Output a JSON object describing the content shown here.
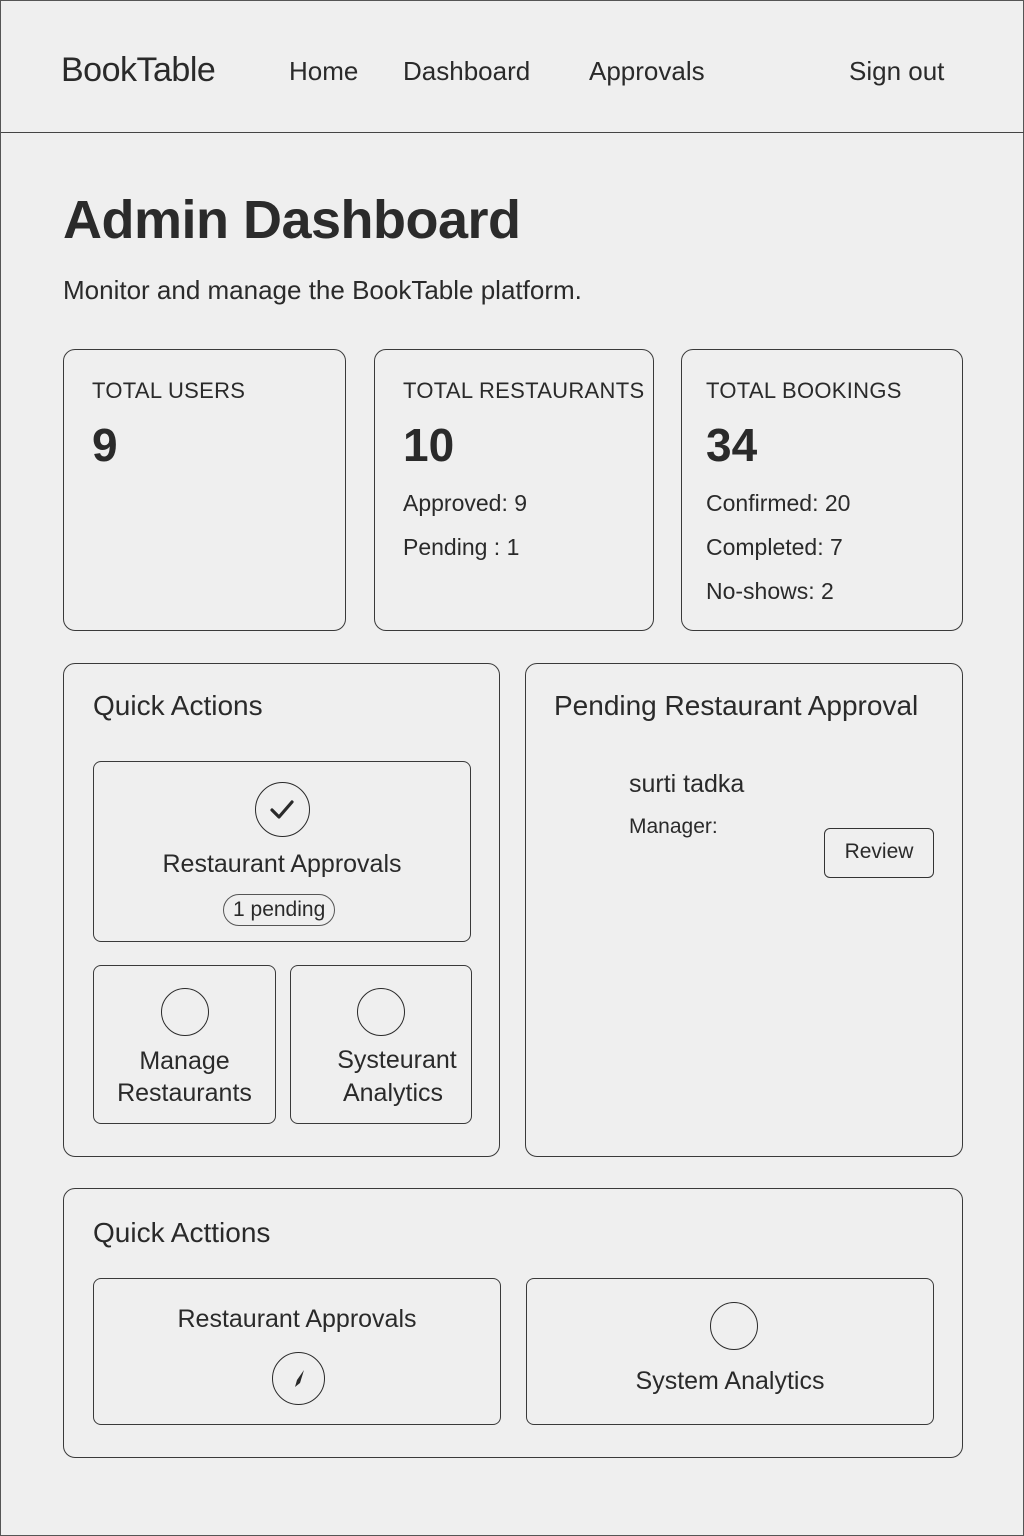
{
  "header": {
    "brand": "BookTable",
    "nav": {
      "home": "Home",
      "dashboard": "Dashboard",
      "approvals": "Approvals",
      "signout": "Sign out"
    }
  },
  "page": {
    "title": "Admin Dashboard",
    "subtitle": "Monitor and manage the BookTable platform."
  },
  "stats": {
    "users": {
      "label": "TOTAL USERS",
      "value": "9"
    },
    "restaurants": {
      "label": "TOTAL RESTAURANTS",
      "value": "10",
      "approved": "Approved:  9",
      "pending": "Pending : 1"
    },
    "bookings": {
      "label": "TOTAL BOOKINGS",
      "value": "34",
      "confirmed": "Confirmed: 20",
      "completed": "Completed: 7",
      "noshows": "No-shows:  2"
    }
  },
  "quick_actions": {
    "title": "Quick Actions",
    "restaurant_approvals": {
      "label": "Restaurant Approvals",
      "badge": "1 pending",
      "icon": "check-circle-icon"
    },
    "manage_restaurants": {
      "line1": "Manage",
      "line2": "Restaurants",
      "icon": "circle-icon"
    },
    "systeurant_analytics": {
      "line1": "Systeurant",
      "line2": "Analytics",
      "icon": "circle-icon"
    }
  },
  "pending_approval": {
    "title": "Pending Restaurant Approval",
    "restaurant_name": "surti tadka",
    "manager_label": "Manager:",
    "review_label": "Review"
  },
  "quick_actions_2": {
    "title": "Quick Acttions",
    "restaurant_approvals": {
      "label": "Restaurant Approvals",
      "icon": "compass-icon"
    },
    "system_analytics": {
      "label": "System Analytics",
      "icon": "circle-icon"
    }
  }
}
